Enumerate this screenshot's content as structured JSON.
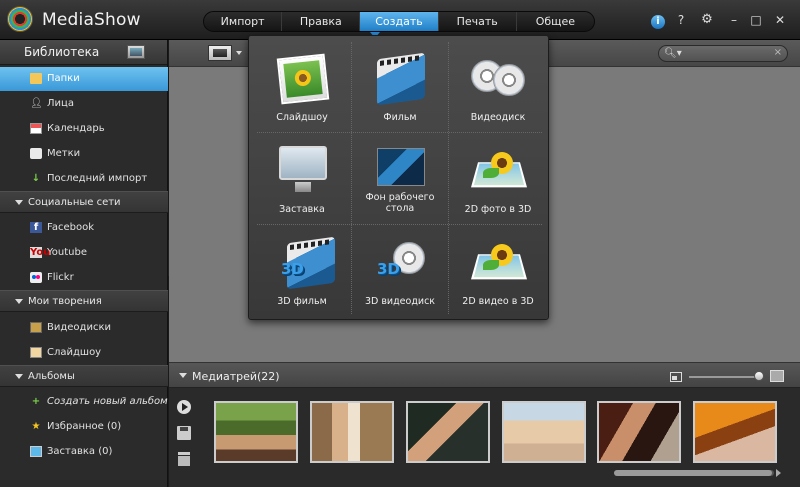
{
  "app": {
    "title": "MediaShow"
  },
  "menu": {
    "tabs": [
      {
        "label": "Импорт"
      },
      {
        "label": "Правка"
      },
      {
        "label": "Создать",
        "active": true
      },
      {
        "label": "Печать"
      },
      {
        "label": "Общее"
      }
    ]
  },
  "window_controls": {
    "info": "i",
    "help": "?",
    "settings": "⚙",
    "minimize": "–",
    "maximize": "□",
    "close": "✕"
  },
  "sidebar": {
    "library_title": "Библиотека",
    "library_items": [
      {
        "label": "Папки",
        "icon": "folder-icon",
        "active": true
      },
      {
        "label": "Лица",
        "icon": "faces-icon"
      },
      {
        "label": "Календарь",
        "icon": "calendar-icon"
      },
      {
        "label": "Метки",
        "icon": "tag-icon"
      },
      {
        "label": "Последний импорт",
        "icon": "recent-import-icon"
      }
    ],
    "social_title": "Социальные сети",
    "social_items": [
      {
        "label": "Facebook",
        "icon": "facebook-icon",
        "glyph": "f"
      },
      {
        "label": "Youtube",
        "icon": "youtube-icon",
        "glyph": "You"
      },
      {
        "label": "Flickr",
        "icon": "flickr-icon"
      }
    ],
    "creations_title": "Мои творения",
    "creations_items": [
      {
        "label": "Видеодиски",
        "icon": "videodisc-icon"
      },
      {
        "label": "Слайдшоу",
        "icon": "slideshow-icon"
      }
    ],
    "albums_title": "Альбомы",
    "albums_items": [
      {
        "label": "Создать новый альбом",
        "icon": "plus-icon",
        "glyph": "+"
      },
      {
        "label": "Избранное (0)",
        "icon": "star-icon",
        "glyph": "★"
      },
      {
        "label": "Заставка (0)",
        "icon": "screensaver-icon"
      }
    ]
  },
  "search": {
    "placeholder": "",
    "clear": "×",
    "icon_glyph": "🔍︎▾"
  },
  "create_menu": {
    "items": [
      {
        "label": "Слайдшоу",
        "icon": "slideshow-icon"
      },
      {
        "label": "Фильм",
        "icon": "movie-icon"
      },
      {
        "label": "Видеодиск",
        "icon": "videodisc-icon"
      },
      {
        "label": "Заставка",
        "icon": "screensaver-icon"
      },
      {
        "label": "Фон рабочего стола",
        "icon": "wallpaper-icon"
      },
      {
        "label": "2D фото в 3D",
        "icon": "photo-3d-icon"
      },
      {
        "label": "3D фильм",
        "icon": "movie-3d-icon",
        "glyph": "3D"
      },
      {
        "label": "3D видеодиск",
        "icon": "videodisc-3d-icon",
        "glyph": "3D"
      },
      {
        "label": "2D видео в 3D",
        "icon": "video-3d-icon"
      }
    ]
  },
  "media_tray": {
    "title": "Медиатрей",
    "count": "(22)",
    "thumbnails": [
      {
        "name": "thumbnail-1"
      },
      {
        "name": "thumbnail-2"
      },
      {
        "name": "thumbnail-3"
      },
      {
        "name": "thumbnail-4"
      },
      {
        "name": "thumbnail-5"
      },
      {
        "name": "thumbnail-6"
      }
    ]
  },
  "colors": {
    "accent": "#3a98d8",
    "active_tab": "#1f7fc8",
    "background": "#2b2b2b"
  }
}
